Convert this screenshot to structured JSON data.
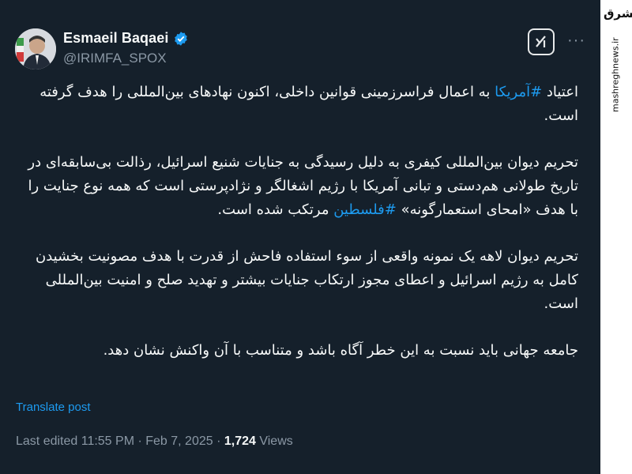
{
  "author": {
    "name": "Esmaeil Baqaei",
    "handle": "@IRIMFA_SPOX"
  },
  "post": {
    "p1": {
      "before": "اعتیاد ",
      "hashtag": "#آمریکا",
      "after": " به اعمال فراسرزمینی قوانین داخلی، اکنون نهادهای بین‌المللی را هدف گرفته است."
    },
    "p2": {
      "before": "تحریم دیوان بین‌المللی کیفری به دلیل رسیدگی به جنایات شنیع اسرائیل، رذالت بی‌سابقه‌ای در  تاریخ طولانی هم‌دستی و تبانی آمریکا با رژیم اشغالگر و نژادپرستی است که همه نوع جنایت را با هدف «امحای استعمارگونه» ",
      "hashtag": "#فلسطین",
      "after": " مرتکب شده است."
    },
    "p3": "تحریم دیوان لاهه یک نمونه واقعی از سوء استفاده فاحش از قدرت با هدف مصونیت بخشیدن کامل به رژیم اسرائیل و اعطای مجوز ارتکاب جنایات بیشتر و تهدید صلح و امنیت بین‌المللی است.",
    "p4": "جامعه جهانی باید نسبت به این خطر آگاه باشد و متناسب با آن واکنش نشان دهد."
  },
  "translate_label": "Translate post",
  "meta": {
    "edited": "Last edited 11:55 PM · Feb 7, 2025 · ",
    "views_count": "1,724",
    "views_label": " Views"
  },
  "watermark": {
    "logo": "مشرق",
    "url": "mashreghnews.ir"
  },
  "colors": {
    "background": "#15202b",
    "text": "#f7f9f9",
    "secondary": "#8b98a5",
    "accent": "#1d9bf0"
  },
  "icons": [
    "verified-badge-icon",
    "grok-icon",
    "more-options-icon"
  ]
}
